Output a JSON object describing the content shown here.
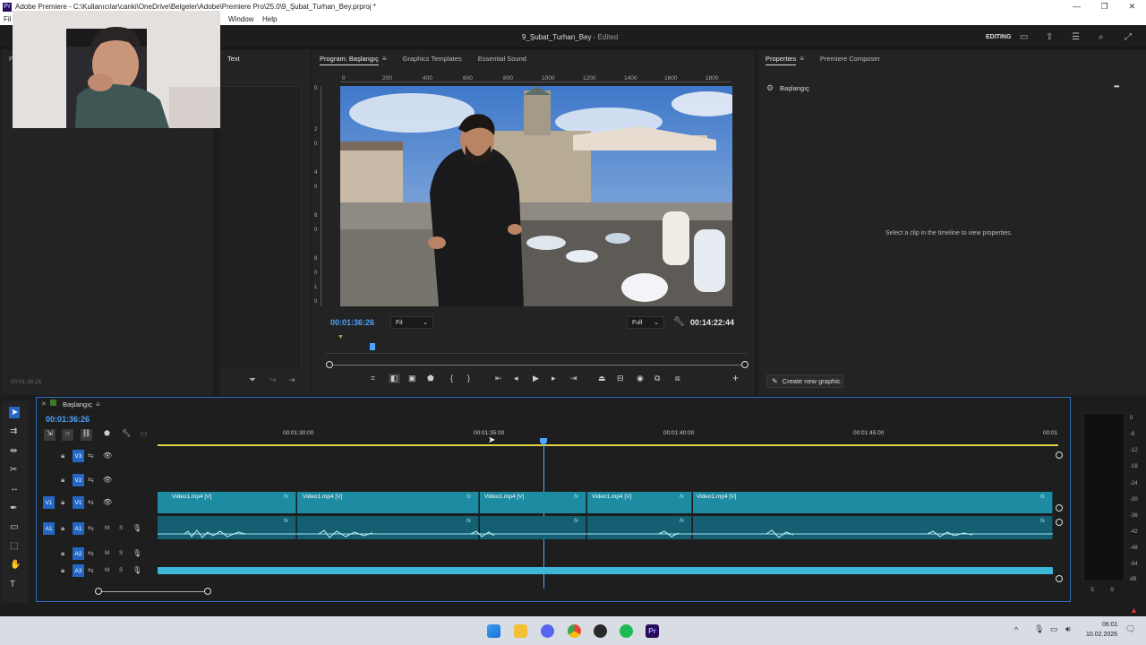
{
  "window": {
    "title": "Adobe Premiere - C:\\Kullanıcılar\\canki\\OneDrive\\Belgeler\\Adobe\\Premiere Pro\\25.0\\9_Şubat_Turhan_Bey.prproj *",
    "minimize": "—",
    "maximize": "❐",
    "close": "✕"
  },
  "menu": {
    "file": "Fil",
    "window": "Window",
    "help": "Help"
  },
  "header": {
    "project": "9_Şubat_Turhan_Bey",
    "status": "- Edited",
    "workspace": "EDITING"
  },
  "left_panel": {
    "tab_initial": "P",
    "timecode": "00:01:36:26"
  },
  "text_panel": {
    "tab": "Text"
  },
  "program_monitor": {
    "tabs": [
      "Program: Başlangıç",
      "Graphics Templates",
      "Essential Sound"
    ],
    "ruler_labels": [
      "0",
      "200",
      "400",
      "600",
      "800",
      "1000",
      "1200",
      "1400",
      "1600",
      "1800"
    ],
    "vruler_labels": [
      "0",
      "2",
      "0",
      "4",
      "0",
      "6",
      "0",
      "8",
      "0",
      "1",
      "0"
    ],
    "timecode_current": "00:01:36:26",
    "timecode_duration": "00:14:22:44",
    "zoom": "Fit",
    "quality": "Full"
  },
  "properties": {
    "tabs": [
      "Properties",
      "Premiere Composer"
    ],
    "sequence": "Başlangıç",
    "empty_message": "Select a clip in the timeline to view properties.",
    "create_graphic": "Create new graphic",
    "more": "•••"
  },
  "timeline": {
    "sequence_name": "Başlangıç",
    "timecode": "00:01:36:26",
    "ruler": [
      "00:01:30:00",
      "00:01:35:00",
      "00:01:40:00",
      "00:01:45:00",
      "00:01"
    ],
    "tracks": [
      {
        "id": "V3",
        "src": ""
      },
      {
        "id": "V2",
        "src": ""
      },
      {
        "id": "V1",
        "src": "V1"
      },
      {
        "id": "A1",
        "src": "A1"
      },
      {
        "id": "A2",
        "src": ""
      },
      {
        "id": "A3",
        "src": ""
      }
    ],
    "clips": [
      "Video1.mp4 [V]",
      "Video1.mp4 [V]",
      "Video1.mp4 [V]",
      "Video1.mp4 [V]",
      "Video1.mp4 [V]"
    ],
    "fx": "fx",
    "mute": "M",
    "solo": "S"
  },
  "vu_meter": {
    "scale": [
      "0",
      "-6",
      "-12",
      "-18",
      "-24",
      "-30",
      "-36",
      "-42",
      "-48",
      "-54",
      "dB"
    ],
    "channels": [
      "S",
      "S"
    ]
  },
  "taskbar": {
    "time": "06:01",
    "date": "10.02.2026"
  },
  "colors": {
    "accent": "#2367c4",
    "timecode": "#4da3ff",
    "clip_video": "#1d8ca3",
    "clip_audio": "#155f73",
    "work_area": "#d8d34a"
  }
}
